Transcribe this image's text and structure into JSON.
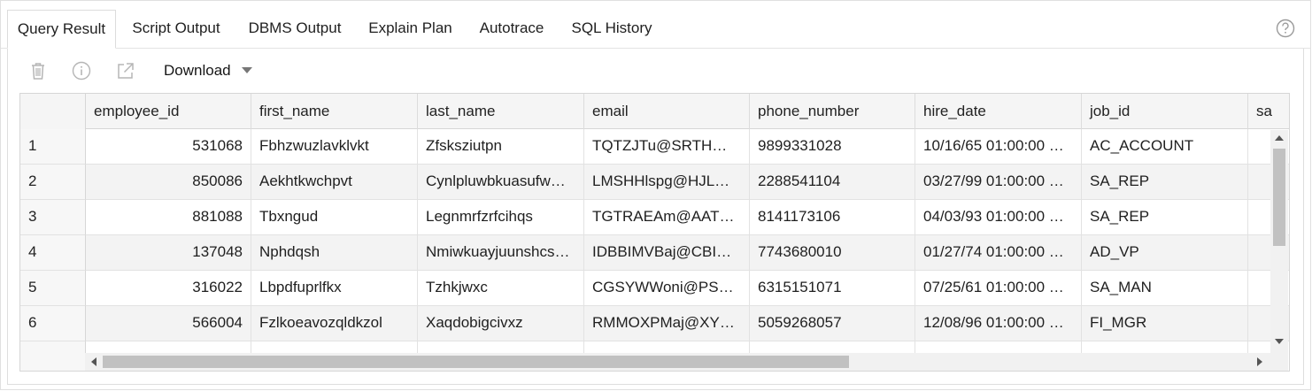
{
  "tabs": [
    {
      "label": "Query Result",
      "active": true
    },
    {
      "label": "Script Output"
    },
    {
      "label": "DBMS Output"
    },
    {
      "label": "Explain Plan"
    },
    {
      "label": "Autotrace"
    },
    {
      "label": "SQL History"
    }
  ],
  "toolbar": {
    "download_label": "Download",
    "icons": [
      "trash-icon",
      "info-icon",
      "open-external-icon",
      "help-icon"
    ]
  },
  "grid": {
    "columns": [
      "employee_id",
      "first_name",
      "last_name",
      "email",
      "phone_number",
      "hire_date",
      "job_id",
      "sa"
    ],
    "rows": [
      {
        "n": "1",
        "employee_id": "531068",
        "first_name": "Fbhzwuzlavklvkt",
        "last_name": "Zfsksziutpn",
        "email": "TQTZJTu@SRTH…",
        "phone_number": "9899331028",
        "hire_date": "10/16/65 01:00:00 …",
        "job_id": "AC_ACCOUNT"
      },
      {
        "n": "2",
        "employee_id": "850086",
        "first_name": "Aekhtkwchpvt",
        "last_name": "Cynlpluwbkuasufw…",
        "email": "LMSHHlspg@HJL…",
        "phone_number": "2288541104",
        "hire_date": "03/27/99 01:00:00 …",
        "job_id": "SA_REP"
      },
      {
        "n": "3",
        "employee_id": "881088",
        "first_name": "Tbxngud",
        "last_name": "Legnmrfzrfcihqs",
        "email": "TGTRAEAm@AAT…",
        "phone_number": "8141173106",
        "hire_date": "04/03/93 01:00:00 …",
        "job_id": "SA_REP"
      },
      {
        "n": "4",
        "employee_id": "137048",
        "first_name": "Nphdqsh",
        "last_name": "Nmiwkuayjuunshcs…",
        "email": "IDBBIMVBaj@CBI…",
        "phone_number": "7743680010",
        "hire_date": "01/27/74 01:00:00 …",
        "job_id": "AD_VP"
      },
      {
        "n": "5",
        "employee_id": "316022",
        "first_name": "Lbpdfuprlfkx",
        "last_name": "Tzhkjwxc",
        "email": "CGSYWWoni@PS…",
        "phone_number": "6315151071",
        "hire_date": "07/25/61 01:00:00 …",
        "job_id": "SA_MAN"
      },
      {
        "n": "6",
        "employee_id": "566004",
        "first_name": "Fzlkoeavozqldkzol",
        "last_name": "Xaqdobigcivxz",
        "email": "RMMOXPMaj@XY…",
        "phone_number": "5059268057",
        "hire_date": "12/08/96 01:00:00 …",
        "job_id": "FI_MGR"
      }
    ]
  }
}
